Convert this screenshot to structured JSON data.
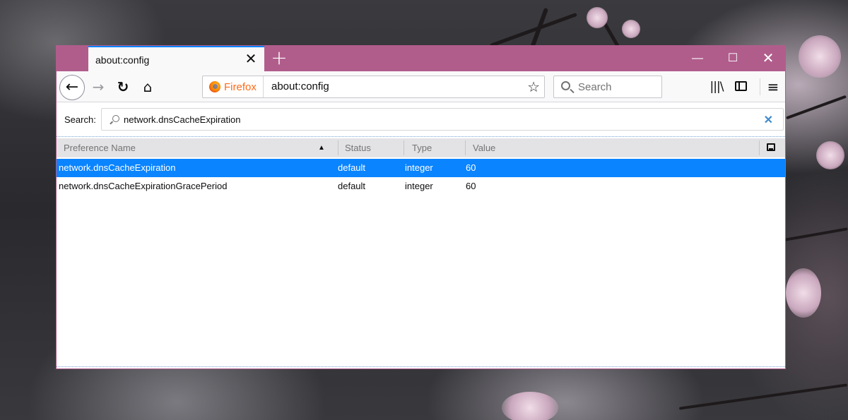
{
  "window": {
    "tab_title": "about:config",
    "tab_close": "✕",
    "new_tab": "+",
    "controls": {
      "minimize": "—",
      "maximize": "☐",
      "close": "✕"
    }
  },
  "navbar": {
    "back": "←",
    "forward": "→",
    "reload": "↻",
    "home": "⌂",
    "identity_label": "Firefox",
    "url": "about:config",
    "bookmark_star": "☆",
    "search_placeholder": "Search",
    "library": "|||\\",
    "menu": "≡"
  },
  "config": {
    "search_label": "Search:",
    "search_value": "network.dnsCacheExpiration",
    "clear": "✕",
    "columns": [
      "Preference Name",
      "Status",
      "Type",
      "Value"
    ],
    "sort_indicator": "▲",
    "rows": [
      {
        "name": "network.dnsCacheExpiration",
        "status": "default",
        "type": "integer",
        "value": "60",
        "selected": true
      },
      {
        "name": "network.dnsCacheExpirationGracePeriod",
        "status": "default",
        "type": "integer",
        "value": "60",
        "selected": false
      }
    ]
  },
  "colors": {
    "titlebar": "#b15d8c",
    "selection": "#0a84ff",
    "tab_accent": "#0a84ff",
    "identity": "#ff6a18"
  }
}
